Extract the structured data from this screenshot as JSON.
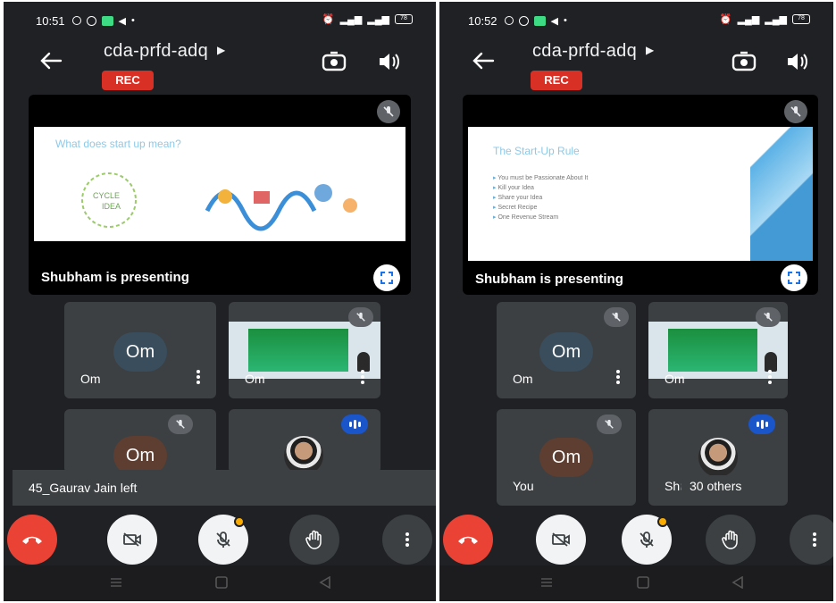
{
  "colors": {
    "accent_red": "#ea4335",
    "rec_red": "#d93025",
    "speaking_blue": "#1a55c9",
    "badge_amber": "#f9ab00",
    "tile_bg": "#3c4043"
  },
  "left": {
    "status": {
      "time": "10:51",
      "battery": "78"
    },
    "meeting": {
      "code": "cda-prfd-adq",
      "rec_label": "REC"
    },
    "presentation": {
      "slide_title": "What does start up mean?",
      "presenter_label": "Shubham is presenting"
    },
    "tiles": [
      {
        "avatar": "Om",
        "name": "Om"
      },
      {
        "name": "Om"
      },
      {
        "avatar": "Om"
      },
      {
        "name": ""
      }
    ],
    "toast": "45_Gaurav Jain left"
  },
  "right": {
    "status": {
      "time": "10:52",
      "battery": "78"
    },
    "meeting": {
      "code": "cda-prfd-adq",
      "rec_label": "REC"
    },
    "presentation": {
      "slide_title": "The Start-Up Rule",
      "bullets": [
        "You must be Passionate About It",
        "Kill your Idea",
        "Share your Idea",
        "Secret Recipe",
        "One Revenue Stream"
      ],
      "presenter_label": "Shubham is presenting"
    },
    "tiles": [
      {
        "avatar": "Om",
        "name": "Om"
      },
      {
        "name": "Om"
      },
      {
        "avatar": "Om",
        "name": "You"
      },
      {
        "name": "Shu"
      }
    ],
    "others": "30 others"
  },
  "icons": [
    "back-arrow-icon",
    "camera-switch-icon",
    "speaker-icon",
    "mic-off-icon",
    "fullscreen-icon",
    "more-vert-icon",
    "end-call-icon",
    "camera-off-icon",
    "raise-hand-icon"
  ]
}
